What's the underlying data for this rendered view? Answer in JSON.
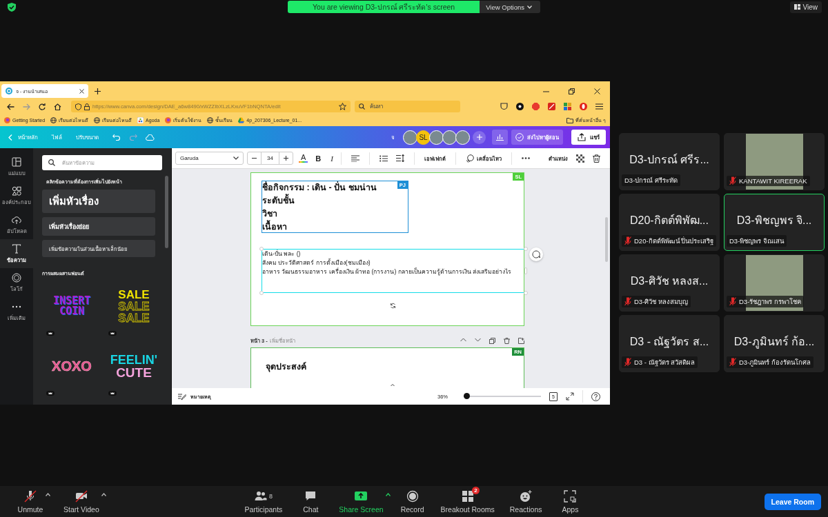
{
  "banner": {
    "text": "You are viewing D3-ปกรณ์ ศรีระทัด's screen",
    "options": "View Options"
  },
  "view_button": "View",
  "browser": {
    "tab_title": "จ - งานนำเสนอ",
    "url": "https://www.canva.com/design/DAE_a6w8490/xWZZIbXLzLKxuVF1bNQNTA/edit",
    "search_placeholder": "ค้นหา",
    "bookmarks": [
      {
        "label": "Getting Started",
        "kind": "firefox"
      },
      {
        "label": "เรียนต่อไหนดี",
        "kind": "globe"
      },
      {
        "label": "เรียนต่อไหนดี",
        "kind": "globe"
      },
      {
        "label": "Agoda",
        "kind": "agoda"
      },
      {
        "label": "เริ่มต้นใช้งาน",
        "kind": "firefox"
      },
      {
        "label": "ชั้นเรียน",
        "kind": "globe"
      },
      {
        "label": "4p_207306_Lecture_01...",
        "kind": "drive"
      }
    ],
    "other_bookmarks": "ที่คั่นหน้าอื่น ๆ"
  },
  "canva": {
    "nav": [
      "หน้าหลัก",
      "ไฟล์",
      "ปรับขนาด"
    ],
    "title": "จ",
    "avatars": [
      {
        "kind": "photo"
      },
      {
        "kind": "initials",
        "text": "SL"
      },
      {
        "kind": "photo"
      },
      {
        "kind": "photo"
      },
      {
        "kind": "photo"
      }
    ],
    "send_button": "ส่งไปหาผู้สอน",
    "share_button": "แชร์",
    "rail": [
      {
        "label": "แม่แบบ",
        "kind": "template",
        "selected": false
      },
      {
        "label": "องค์ประกอบ",
        "kind": "elements",
        "selected": false
      },
      {
        "label": "อัปโหลด",
        "kind": "upload",
        "selected": false
      },
      {
        "label": "ข้อความ",
        "kind": "text",
        "selected": true
      },
      {
        "label": "โลโก้",
        "kind": "logo",
        "selected": false
      },
      {
        "label": "เพิ่มเติม",
        "kind": "more",
        "selected": false
      }
    ],
    "panel": {
      "search_placeholder": "ค้นหาข้อความ",
      "hint": "คลิกข้อความที่ต้องการเพิ่มไปยังหน้า",
      "add_heading": "เพิ่มหัวเรื่อง",
      "add_subheading": "เพิ่มหัวเรื่องย่อย",
      "add_body": "เพิ่มข้อความในส่วนเนื้อหาเล็กน้อย",
      "combos_title": "การผสมผสานฟอนต์",
      "combos": [
        {
          "kind": "insert",
          "lines": [
            "INSERT",
            "COIN"
          ]
        },
        {
          "kind": "sale",
          "lines": [
            "SALE",
            "SALE",
            "SALE"
          ]
        },
        {
          "kind": "xoxo",
          "lines": [
            "XOXO"
          ]
        },
        {
          "kind": "feelin",
          "lines": [
            "FEELIN'",
            "CUTE"
          ]
        }
      ]
    },
    "toolbar": {
      "font": "Garuda",
      "size": "34",
      "text_color": "A",
      "bold": "B",
      "italic": "I",
      "effects": "เอฟเฟกต์",
      "animate": "เคลื่อนไหว",
      "position": "ตำแหน่ง"
    },
    "page": {
      "badge": "SL",
      "box_badge": "PJ",
      "title_lines": [
        "ชื่อกิจกรรม : เดิน - ปั่น ชมน่าน",
        "ระดับชั้น",
        "วิชา",
        "เนื้อหา"
      ],
      "body_lines": [
        "เดิน-ปั่น พละ ()",
        "สังคม ประวัติศาสตร์ การตั้งเมือง(ชมเมือง)",
        "อาหาร วัฒนธรรมอาหาร เครื่องเงิน ผ้าทอ (การงาน) กลายเป็นความรู้ด้านการเงิน ส่งเสริมอย่างไร"
      ]
    },
    "next_page": {
      "label": "หน้า 3 -",
      "add_title": "เพิ่มชื่อหน้า",
      "badge": "RN",
      "heading": "จุดประสงค์"
    },
    "footer": {
      "notes": "หมายเหตุ",
      "zoom": "36%",
      "level": 0.02,
      "pages": "5"
    }
  },
  "participants": [
    {
      "kind": "name",
      "big_name": "D3-ปกรณ์ ศรีร...",
      "name": "D3-ปกรณ์ ศรีระทัด",
      "muted": false,
      "selected": false
    },
    {
      "kind": "photo",
      "name": "KANTAWIT KIREERAK",
      "muted": true,
      "selected": false
    },
    {
      "kind": "name",
      "big_name": "D20-กิตต์พิพัฒ...",
      "name": "D20-กิตต์พิพัฒน์ ปิ่นประเสริฐ",
      "muted": true,
      "selected": false
    },
    {
      "kind": "name",
      "big_name": "D3-พิชญพร จิ...",
      "name": "D3-พิชญพร จิณเสน",
      "muted": false,
      "selected": true
    },
    {
      "kind": "name",
      "big_name": "D3-ศิวัช หลงส...",
      "name": "D3-ศิวัช หลงสมบุญ",
      "muted": true,
      "selected": false
    },
    {
      "kind": "photo",
      "name": "D3-รัชฎาพร กรพาโชค",
      "muted": true,
      "selected": false
    },
    {
      "kind": "name",
      "big_name": "D3 - ณัฐวัตร ส...",
      "name": "D3 - ณัฐวัตร สวัสดิผล",
      "muted": true,
      "selected": false
    },
    {
      "kind": "name",
      "big_name": "D3-ภูมินทร์ ก้อ...",
      "name": "D3-ภูมินทร์ ก้องรัตนโกศล",
      "muted": true,
      "selected": false
    }
  ],
  "controls_left": [
    {
      "kind": "mic",
      "label": "Unmute",
      "off": true,
      "caret": true
    },
    {
      "kind": "video",
      "label": "Start Video",
      "off": true,
      "caret": true
    }
  ],
  "controls_center": [
    {
      "kind": "participants",
      "label": "Participants",
      "count": "8",
      "caret": false
    },
    {
      "kind": "chat",
      "label": "Chat",
      "caret": false
    },
    {
      "kind": "share",
      "label": "Share Screen",
      "caret": true
    },
    {
      "kind": "record",
      "label": "Record",
      "caret": false
    },
    {
      "kind": "breakout",
      "label": "Breakout Rooms",
      "badge": "2",
      "caret": false
    },
    {
      "kind": "reactions",
      "label": "Reactions",
      "caret": false
    },
    {
      "kind": "apps",
      "label": "Apps",
      "caret": false
    }
  ],
  "leave_button": "Leave Room"
}
